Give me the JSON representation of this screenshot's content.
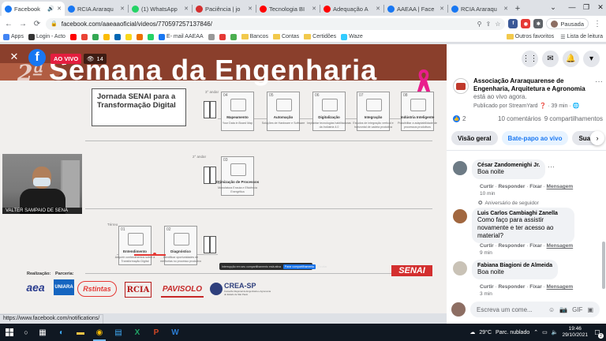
{
  "browser": {
    "tabs": [
      {
        "label": "Facebook",
        "icon": "facebook-icon",
        "color": "#1877f2",
        "active": true,
        "audio": true
      },
      {
        "label": "RCIA Araraqu",
        "icon": "facebook-icon",
        "color": "#1877f2"
      },
      {
        "label": "(1) WhatsApp",
        "icon": "whatsapp-icon",
        "color": "#25d366"
      },
      {
        "label": "Paciência | jo",
        "icon": "cards-icon",
        "color": "#d32f2f"
      },
      {
        "label": "Tecnologia BI",
        "icon": "youtube-icon",
        "color": "#ff0000"
      },
      {
        "label": "Adequação A",
        "icon": "youtube-icon",
        "color": "#ff0000"
      },
      {
        "label": "AAEAA | Face",
        "icon": "facebook-icon",
        "color": "#1877f2"
      },
      {
        "label": "RCIA Araraqu",
        "icon": "facebook-icon",
        "color": "#1877f2"
      }
    ],
    "url": "facebook.com/aaeaaoficial/videos/770597257137846/",
    "profile_label": "Pausada",
    "bookmarks": [
      {
        "label": "Apps",
        "icon": "apps-icon",
        "color": "#4285f4"
      },
      {
        "label": "Login - Acto",
        "icon": "acto-icon",
        "color": "#333333"
      },
      {
        "label": "",
        "icon": "youtube-icon",
        "color": "#ff0000"
      },
      {
        "label": "",
        "icon": "gmail-icon",
        "color": "#ea4335"
      },
      {
        "label": "",
        "icon": "chrome-icon",
        "color": "#34a853"
      },
      {
        "label": "",
        "icon": "drive-icon",
        "color": "#fbbc04"
      },
      {
        "label": "",
        "icon": "bank-icon",
        "color": "#0066b3"
      },
      {
        "label": "",
        "icon": "bb-icon",
        "color": "#f9d71c"
      },
      {
        "label": "",
        "icon": "itau-icon",
        "color": "#ec7000"
      },
      {
        "label": "",
        "icon": "whatsapp-icon",
        "color": "#25d366"
      },
      {
        "label": "E- mail AAEAA",
        "icon": "mail-icon",
        "color": "#1877f2"
      },
      {
        "label": "",
        "icon": "bookmark-icon",
        "color": "#999999"
      },
      {
        "label": "",
        "icon": "bookmark-icon",
        "color": "#e53935"
      },
      {
        "label": "",
        "icon": "bookmark-icon",
        "color": "#4caf50"
      },
      {
        "label": "Bancos",
        "icon": "folder-icon",
        "folder": true
      },
      {
        "label": "Contas",
        "icon": "folder-icon",
        "folder": true
      },
      {
        "label": "Certidões",
        "icon": "folder-icon",
        "folder": true
      },
      {
        "label": "Waze",
        "icon": "waze-icon",
        "color": "#33ccff"
      }
    ],
    "bookmarks_right": [
      "Outros favoritos",
      "Lista de leitura"
    ],
    "status_url": "https://www.facebook.com/notifications/"
  },
  "video": {
    "live_label": "AO VIVO",
    "viewers": "14",
    "title_ordinal": "2ª",
    "title_text": "Semana da Engenharia",
    "slide": {
      "heading": "Jornada SENAI para a Transformação Digital",
      "level3": "3° andar",
      "level2": "2° andar",
      "ground": "Térreo",
      "steps": [
        {
          "num": "04",
          "title": "Mapeamento",
          "desc": "Your Data in Board Map"
        },
        {
          "num": "05",
          "title": "Automação",
          "desc": "Soluções de Hardware e Software"
        },
        {
          "num": "06",
          "title": "Digitalização",
          "desc": "Implantar tecnologias habilitadoras da Indústria 4.0"
        },
        {
          "num": "07",
          "title": "Integração",
          "desc": "Estudos de integração vertical e horizontal de cadeia produtiva"
        },
        {
          "num": "08",
          "title": "Indústria Inteligente",
          "desc": "Possibilitar a adaptabilidade de processos produtivos"
        },
        {
          "num": "03",
          "title": "Otimização de Processos",
          "desc": "Manufatura Enxuta e Eficiência Energética"
        },
        {
          "num": "01",
          "title": "Entendimento",
          "desc": "Adquirir conhecimentos sobre a Transformação Digital"
        },
        {
          "num": "02",
          "title": "Diagnóstico",
          "desc": "Identificar oportunidades de melhorias no processo produtivo"
        }
      ],
      "share_text": "Interrupção em seu compartilhamento está ativa",
      "share_btn": "Parar compartilhamento",
      "share_hide": "Ocultar",
      "brand": "SENAI",
      "realizacao_label": "Realização:",
      "parceria_label": "Parceria:",
      "logos": [
        "aea",
        "UNIARA",
        "Rstintas",
        "RCIA",
        "PAVISOLO",
        "CREA-SP"
      ],
      "crea_sub": "Conselho Regional de Engenharia e Agronomia do Estado de São Paulo"
    },
    "speaker_name": "VALTER SAMPAIO DE SENA"
  },
  "panel": {
    "page_name": "Associação Araraquarense de Engenharia, Arquitetura e Agronomia",
    "live_suffix": "está ao vivo agora.",
    "published_by": "Publicado por StreamYard",
    "time_ago": "39 min",
    "reactions": "2",
    "comments_count": "10 comentários",
    "shares_count": "9 compartilhamentos",
    "pills": [
      "Visão geral",
      "Bate-papo ao vivo",
      "Suas"
    ],
    "fan_badge": "Aniversário de seguidor",
    "comments": [
      {
        "name": "César Zandomenighi Jr.",
        "text": "Boa noite",
        "time": "10 min",
        "avatar": "#6d7b85"
      },
      {
        "name": "Luis Carlos Cambiaghi Zanella",
        "text": "Como faço para assistir novamente e ter acesso ao material?",
        "time": "9 min",
        "avatar": "#a1673f"
      },
      {
        "name": "Fabiana Biagioni de Almeida",
        "text": "Boa noite",
        "time": "3 min",
        "avatar": "#c9c2b6"
      }
    ],
    "actions": {
      "like": "Curtir",
      "reply": "Responder",
      "pin": "Fixar",
      "message": "Mensagem"
    },
    "composer_placeholder": "Escreva um come..."
  },
  "taskbar": {
    "temperature": "29°C",
    "weather": "Parc. nublado",
    "time": "19:46",
    "date": "29/10/2021",
    "notifications": "2"
  }
}
